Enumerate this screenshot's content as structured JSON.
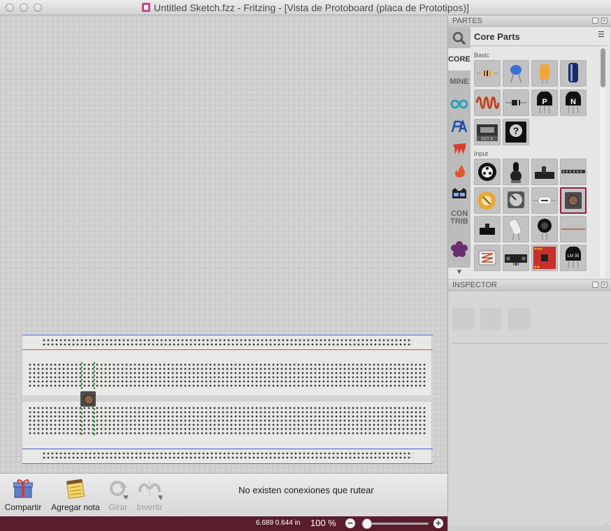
{
  "window": {
    "title": "Untitled Sketch.fzz - Fritzing - [Vista de Protoboard (placa de Prototipos)]"
  },
  "parts_panel": {
    "header": "PARTES",
    "bin_tabs": [
      "CORE",
      "MINE",
      "CON TRIB"
    ],
    "bin_title": "Core Parts",
    "sections": [
      "Basic",
      "Input"
    ],
    "basic_parts": [
      "resistor-icon",
      "ceramic-capacitor-icon",
      "electrolytic-capacitor-icon",
      "battery-capacitor-icon",
      "inductor-icon",
      "diode-icon",
      "pnp-transistor-icon",
      "npn-transistor-icon",
      "fet-icon",
      "mystery-part-icon"
    ],
    "basic_labels": {
      "pnp": "P",
      "npn": "N",
      "fet": "FET P",
      "mystery": "?"
    },
    "input_labels": {
      "lm35": "LM 35"
    }
  },
  "inspector": {
    "header": "INSPECTOR"
  },
  "toolbar": {
    "share": "Compartir",
    "add_note": "Agregar nota",
    "rotate": "Girar",
    "flip": "Invertir",
    "routing_status": "No existen conexiones que rutear"
  },
  "statusbar": {
    "coordinates": "6.689 0.644 in",
    "zoom": "100 %",
    "zoom_level": 100
  },
  "colors": {
    "statusbar": "#5a1d2d",
    "selection": "#8b2240",
    "rail_red": "#d94c4c",
    "rail_blue": "#3d5fd1"
  }
}
